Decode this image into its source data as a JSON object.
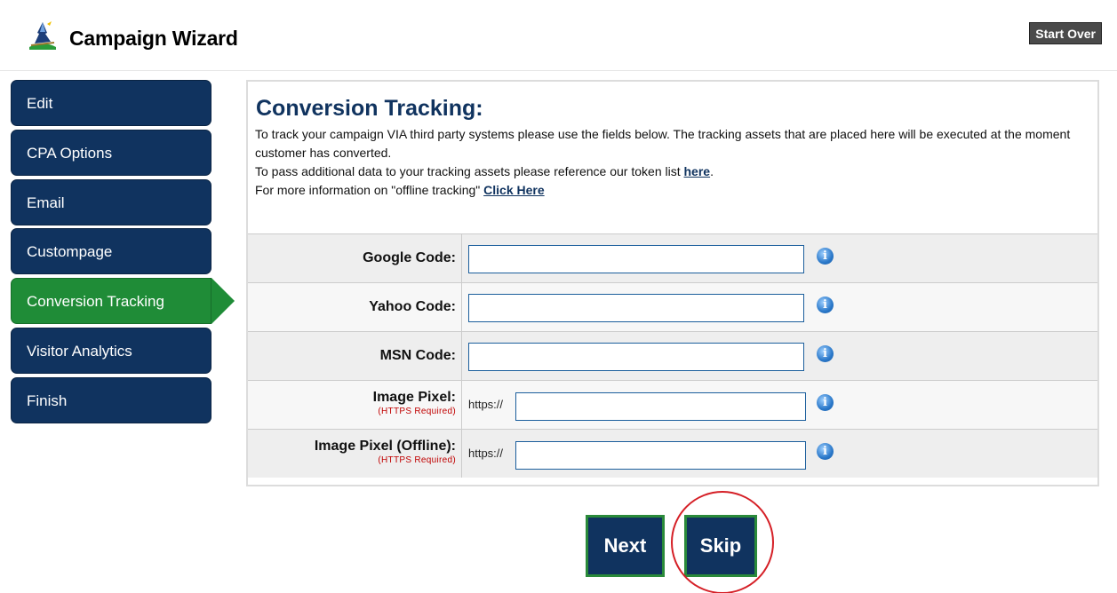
{
  "header": {
    "title": "Campaign Wizard",
    "start_over_label": "Start Over"
  },
  "sidebar": {
    "items": [
      {
        "label": "Edit",
        "active": false
      },
      {
        "label": "CPA Options",
        "active": false
      },
      {
        "label": "Email",
        "active": false
      },
      {
        "label": "Custompage",
        "active": false
      },
      {
        "label": "Conversion Tracking",
        "active": true
      },
      {
        "label": "Visitor Analytics",
        "active": false
      },
      {
        "label": "Finish",
        "active": false
      }
    ]
  },
  "main": {
    "title": "Conversion Tracking:",
    "desc_line1": "To track your campaign VIA third party systems please use the fields below. The tracking assets that are placed here will be executed at the moment customer has converted.",
    "desc_line2_prefix": "To pass additional data to your tracking assets please reference our token list ",
    "desc_line2_link": "here",
    "desc_line2_suffix": ".",
    "desc_line3_prefix": "For more information on \"offline tracking\" ",
    "desc_line3_link": "Click Here",
    "fields": [
      {
        "label": "Google Code:",
        "sublabel": "",
        "prefix": "",
        "value": ""
      },
      {
        "label": "Yahoo Code:",
        "sublabel": "",
        "prefix": "",
        "value": ""
      },
      {
        "label": "MSN Code:",
        "sublabel": "",
        "prefix": "",
        "value": ""
      },
      {
        "label": "Image Pixel:",
        "sublabel": "(HTTPS Required)",
        "prefix": "https://",
        "value": ""
      },
      {
        "label": "Image Pixel (Offline):",
        "sublabel": "(HTTPS Required)",
        "prefix": "https://",
        "value": ""
      }
    ],
    "info_icon_glyph": "i"
  },
  "buttons": {
    "next_label": "Next",
    "skip_label": "Skip"
  },
  "icons": {
    "logo": "wizard-logo-icon",
    "info": "info-icon"
  },
  "colors": {
    "nav_bg": "#10335f",
    "nav_active": "#1f8c37",
    "title": "#10335f",
    "required": "#c00000",
    "highlight": "#d51f26"
  }
}
